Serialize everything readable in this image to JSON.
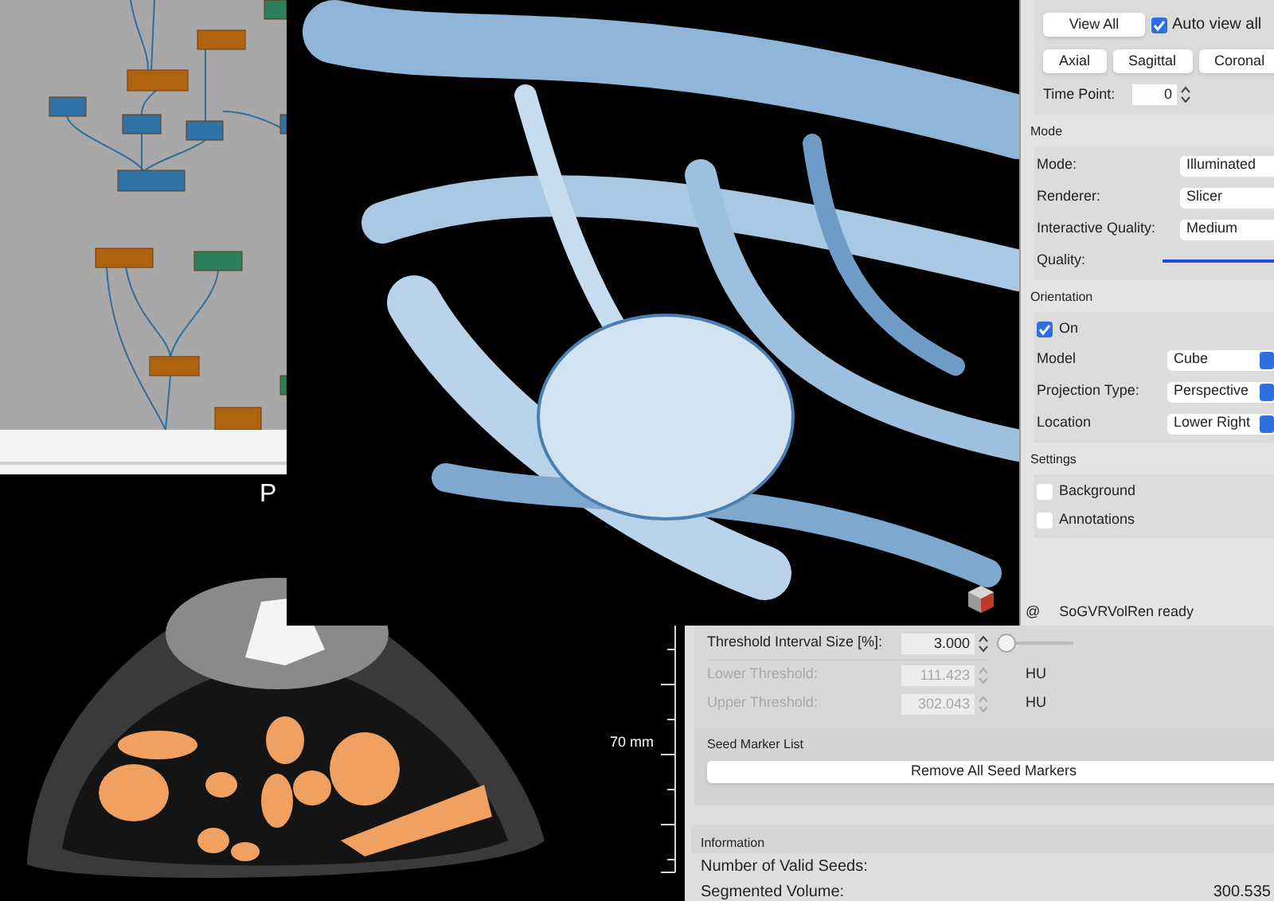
{
  "ct_view": {
    "orientation_label": "P",
    "scale_label": "70 mm"
  },
  "viewer_panel": {
    "view_all_button": "View All",
    "auto_view_all": {
      "label": "Auto view all",
      "checked": true
    },
    "view_buttons": [
      "Axial",
      "Sagittal",
      "Coronal"
    ],
    "time_point": {
      "label": "Time Point:",
      "value": "0"
    },
    "groups": [
      {
        "title": "Mode",
        "rows": [
          {
            "kind": "wide-select",
            "label": "Mode:",
            "value": "Illuminated"
          },
          {
            "kind": "wide-select",
            "label": "Renderer:",
            "value": "Slicer"
          },
          {
            "kind": "wide-select",
            "label": "Interactive Quality:",
            "value": "Medium"
          },
          {
            "kind": "slider",
            "label": "Quality:"
          }
        ]
      },
      {
        "title": "Orientation",
        "rows": [
          {
            "kind": "checkbox",
            "label": "On",
            "checked": true
          },
          {
            "kind": "select",
            "label": "Model",
            "value": "Cube"
          },
          {
            "kind": "select",
            "label": "Projection Type:",
            "value": "Perspective"
          },
          {
            "kind": "select",
            "label": "Location",
            "value": "Lower Right"
          }
        ]
      },
      {
        "title": "Settings",
        "rows": [
          {
            "kind": "checkbox",
            "label": "Background",
            "checked": false
          },
          {
            "kind": "checkbox",
            "label": "Annotations",
            "checked": false
          }
        ]
      }
    ],
    "status": {
      "symbol": "@",
      "text": "SoGVRVolRen ready"
    }
  },
  "segmentation_panel": {
    "threshold_interval": {
      "label": "Threshold Interval Size [%]:",
      "value": "3.000",
      "level": 0
    },
    "thresholds": [
      {
        "label": "Lower Threshold:",
        "value": "111.423",
        "unit": "HU",
        "disabled": true
      },
      {
        "label": "Upper Threshold:",
        "value": "302.043",
        "unit": "HU",
        "disabled": true
      }
    ],
    "seed_marker_list": {
      "title": "Seed Marker List",
      "button": "Remove All Seed Markers"
    },
    "information": {
      "title": "Information",
      "rows": [
        {
          "label": "Number of Valid Seeds:"
        },
        {
          "label": "Segmented Volume:",
          "value": "300.535"
        }
      ]
    }
  }
}
